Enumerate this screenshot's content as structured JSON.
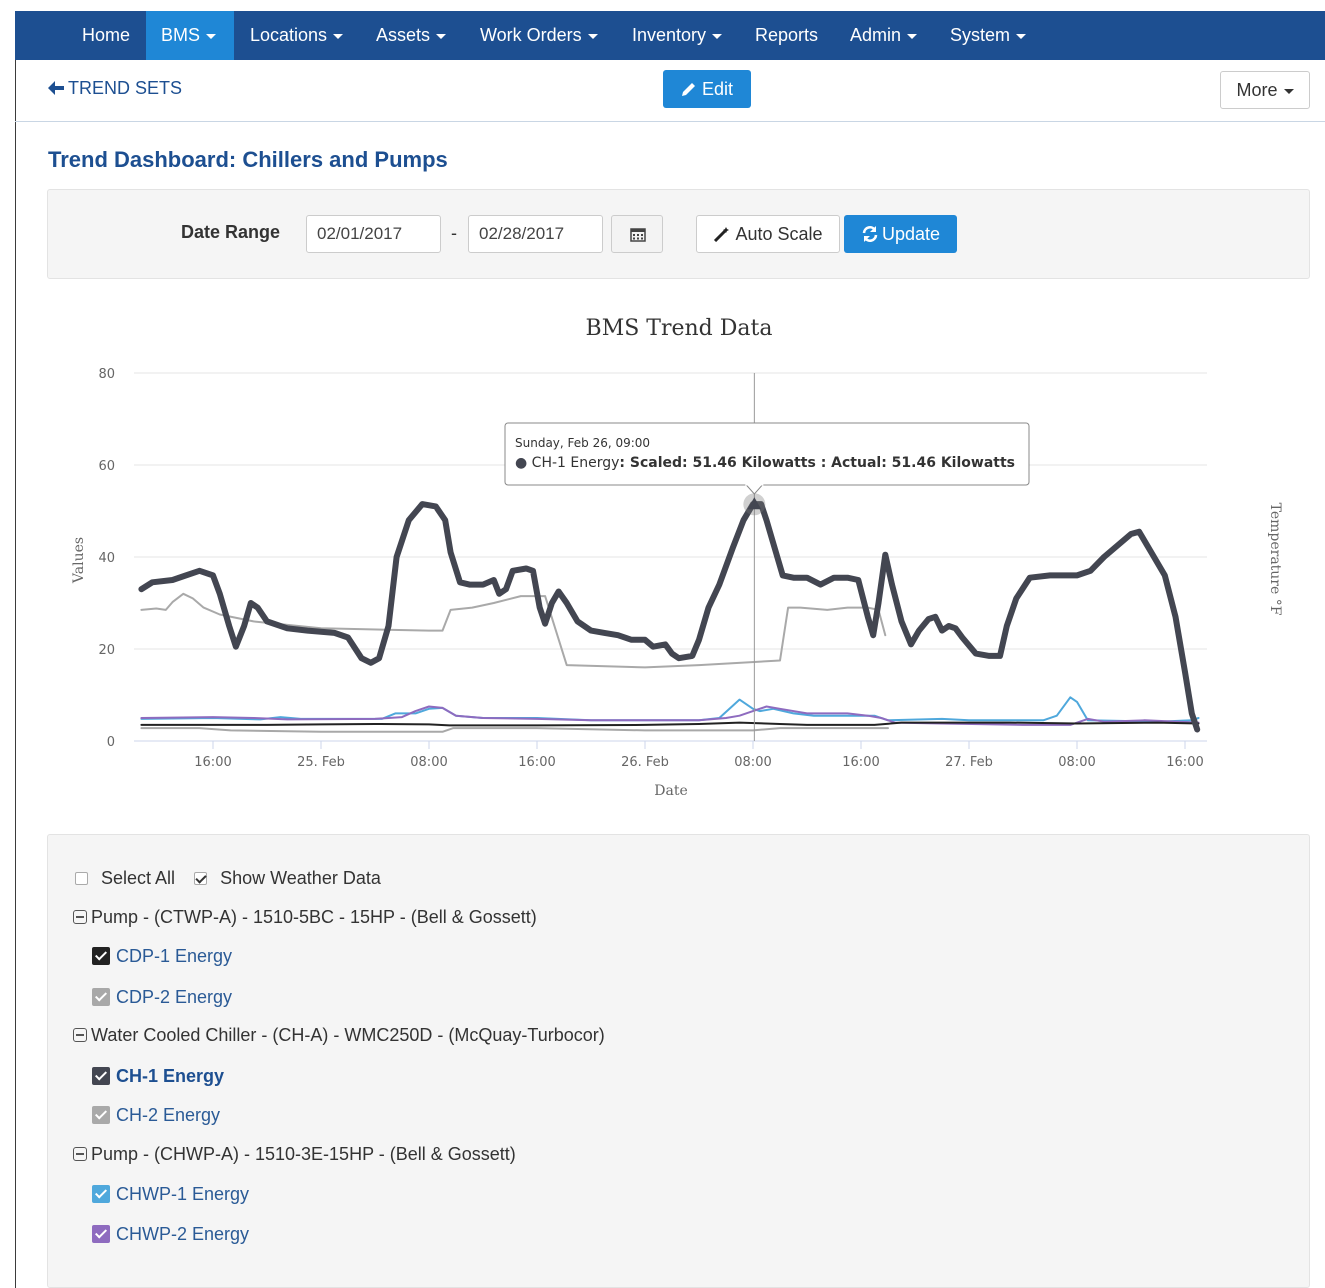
{
  "nav": {
    "items": [
      {
        "label": "Home",
        "caret": false,
        "active": false
      },
      {
        "label": "BMS",
        "caret": true,
        "active": true
      },
      {
        "label": "Locations",
        "caret": true,
        "active": false
      },
      {
        "label": "Assets",
        "caret": true,
        "active": false
      },
      {
        "label": "Work Orders",
        "caret": true,
        "active": false
      },
      {
        "label": "Inventory",
        "caret": true,
        "active": false
      },
      {
        "label": "Reports",
        "caret": false,
        "active": false
      },
      {
        "label": "Admin",
        "caret": true,
        "active": false
      },
      {
        "label": "System",
        "caret": true,
        "active": false
      }
    ]
  },
  "toolbar": {
    "back_label": "TREND SETS",
    "edit_label": "Edit",
    "more_label": "More"
  },
  "page": {
    "title": "Trend Dashboard: Chillers and Pumps"
  },
  "filters": {
    "date_range_label": "Date Range",
    "start_date": "02/01/2017",
    "separator": "-",
    "end_date": "02/28/2017",
    "autoscale_label": "Auto Scale",
    "update_label": "Update"
  },
  "colors": {
    "nav_bg": "#1d4f91",
    "nav_active": "#1f87d6",
    "primary": "#1f87d6",
    "ch1": "#434651",
    "ch2": "#a9a9a9",
    "chwp1": "#4fa8dc",
    "chwp2": "#8e6bbf",
    "cdp1": "#222222",
    "cdp2": "#a8a8a8"
  },
  "chart_data": {
    "type": "line",
    "title": "BMS Trend Data",
    "xlabel": "Date",
    "ylabel": "Values",
    "y2label": "Temperature °F",
    "ylim": [
      0,
      80
    ],
    "yticks": [
      0,
      20,
      40,
      60,
      80
    ],
    "x_unit": "hours since 2017-02-24 00:00",
    "xlim": [
      10.2,
      66.4
    ],
    "xticks": [
      {
        "x": 16,
        "label": "16:00"
      },
      {
        "x": 24,
        "label": "25. Feb"
      },
      {
        "x": 32,
        "label": "08:00"
      },
      {
        "x": 40,
        "label": "16:00"
      },
      {
        "x": 48,
        "label": "26. Feb"
      },
      {
        "x": 56,
        "label": "08:00"
      },
      {
        "x": 64,
        "label": "16:00"
      },
      {
        "x": 72,
        "label": "27. Feb"
      },
      {
        "x": 80,
        "label": "08:00"
      },
      {
        "x": 88,
        "label": "16:00"
      }
    ],
    "grid": true,
    "series": [
      {
        "name": "CH-2 Energy",
        "color": "#a9a9a9",
        "width": 2,
        "points": [
          [
            10.7,
            28.5
          ],
          [
            11.8,
            28.8
          ],
          [
            12.5,
            28.5
          ],
          [
            13.0,
            30.2
          ],
          [
            13.8,
            32.0
          ],
          [
            14.5,
            31.0
          ],
          [
            15.3,
            29.0
          ],
          [
            16.5,
            27.5
          ],
          [
            19.0,
            26.0
          ],
          [
            24.0,
            24.5
          ],
          [
            32.0,
            24.0
          ],
          [
            33.0,
            24.0
          ],
          [
            33.6,
            28.5
          ],
          [
            35.2,
            29.0
          ],
          [
            36.8,
            30.0
          ],
          [
            38.8,
            31.5
          ],
          [
            40.6,
            31.5
          ],
          [
            42.2,
            16.5
          ],
          [
            48.0,
            16.0
          ],
          [
            52.0,
            16.5
          ],
          [
            58.0,
            17.5
          ],
          [
            58.6,
            29.0
          ],
          [
            59.5,
            29.0
          ],
          [
            61.5,
            28.5
          ],
          [
            63.0,
            29.0
          ],
          [
            64.5,
            29.0
          ],
          [
            65.3,
            28.5
          ],
          [
            65.8,
            23.0
          ]
        ]
      },
      {
        "name": "CDP-2 Energy",
        "color": "#a8a8a8",
        "width": 2,
        "points": [
          [
            10.7,
            2.8
          ],
          [
            15.0,
            2.8
          ],
          [
            17.3,
            2.3
          ],
          [
            24.0,
            2.0
          ],
          [
            33.0,
            2.0
          ],
          [
            33.8,
            2.8
          ],
          [
            40.0,
            2.8
          ],
          [
            48.0,
            2.3
          ],
          [
            56.0,
            2.3
          ],
          [
            58.0,
            2.8
          ],
          [
            66.0,
            2.8
          ]
        ]
      },
      {
        "name": "CHWP-1 Energy",
        "color": "#4fa8dc",
        "width": 2,
        "points": [
          [
            10.7,
            4.8
          ],
          [
            16.0,
            5.0
          ],
          [
            19.5,
            4.7
          ],
          [
            21.0,
            5.2
          ],
          [
            22.5,
            4.8
          ],
          [
            28.5,
            4.8
          ],
          [
            29.5,
            6.0
          ],
          [
            31.0,
            6.0
          ],
          [
            32.0,
            7.0
          ],
          [
            33.0,
            7.2
          ],
          [
            34.0,
            5.5
          ],
          [
            36.0,
            5.0
          ],
          [
            40.0,
            5.0
          ],
          [
            44.0,
            4.5
          ],
          [
            52.0,
            4.5
          ],
          [
            53.5,
            5.0
          ],
          [
            55.0,
            9.0
          ],
          [
            56.0,
            7.0
          ],
          [
            56.5,
            6.5
          ],
          [
            57.5,
            7.0
          ],
          [
            59.0,
            6.0
          ],
          [
            60.5,
            5.5
          ],
          [
            65.0,
            5.5
          ],
          [
            66.0,
            4.5
          ],
          [
            70.0,
            4.8
          ],
          [
            72.0,
            4.5
          ],
          [
            77.5,
            4.5
          ],
          [
            78.5,
            5.5
          ],
          [
            79.5,
            9.5
          ],
          [
            80.0,
            8.5
          ],
          [
            80.8,
            4.5
          ],
          [
            86.0,
            4.2
          ],
          [
            88.5,
            4.5
          ],
          [
            89.0,
            5.0
          ]
        ]
      },
      {
        "name": "CHWP-2 Energy",
        "color": "#8e6bbf",
        "width": 2,
        "points": [
          [
            10.7,
            5.0
          ],
          [
            16.0,
            5.2
          ],
          [
            19.0,
            5.0
          ],
          [
            21.5,
            4.7
          ],
          [
            28.0,
            4.8
          ],
          [
            30.0,
            5.2
          ],
          [
            31.0,
            6.5
          ],
          [
            32.0,
            7.5
          ],
          [
            33.0,
            7.2
          ],
          [
            34.0,
            5.5
          ],
          [
            36.0,
            5.0
          ],
          [
            40.0,
            4.8
          ],
          [
            44.0,
            4.5
          ],
          [
            52.0,
            4.5
          ],
          [
            54.0,
            5.0
          ],
          [
            55.0,
            5.5
          ],
          [
            56.0,
            6.5
          ],
          [
            57.0,
            7.5
          ],
          [
            58.0,
            7.0
          ],
          [
            60.0,
            6.0
          ],
          [
            63.0,
            6.0
          ],
          [
            64.5,
            5.5
          ],
          [
            65.5,
            5.0
          ],
          [
            66.5,
            4.0
          ],
          [
            70.0,
            3.8
          ],
          [
            76.0,
            3.5
          ],
          [
            79.5,
            3.5
          ],
          [
            80.8,
            4.8
          ],
          [
            82.0,
            4.2
          ],
          [
            85.0,
            4.5
          ],
          [
            87.5,
            4.2
          ],
          [
            89.0,
            4.0
          ]
        ]
      },
      {
        "name": "CDP-1 Energy",
        "color": "#222222",
        "width": 2,
        "points": [
          [
            10.7,
            3.5
          ],
          [
            20.0,
            3.5
          ],
          [
            24.0,
            3.6
          ],
          [
            28.0,
            3.7
          ],
          [
            32.0,
            3.6
          ],
          [
            33.5,
            3.4
          ],
          [
            40.0,
            3.4
          ],
          [
            48.0,
            3.5
          ],
          [
            52.0,
            3.7
          ],
          [
            55.0,
            4.0
          ],
          [
            58.0,
            3.7
          ],
          [
            60.0,
            3.5
          ],
          [
            65.0,
            3.5
          ],
          [
            67.0,
            4.0
          ],
          [
            75.0,
            4.0
          ],
          [
            80.0,
            3.8
          ],
          [
            86.0,
            4.0
          ],
          [
            89.0,
            3.8
          ]
        ]
      },
      {
        "name": "CH-1 Energy",
        "color": "#434651",
        "width": 6,
        "points": [
          [
            10.7,
            33.0
          ],
          [
            11.5,
            34.5
          ],
          [
            13.0,
            35.0
          ],
          [
            14.0,
            36.0
          ],
          [
            15.0,
            37.0
          ],
          [
            16.0,
            36.0
          ],
          [
            16.5,
            32.0
          ],
          [
            17.2,
            25.0
          ],
          [
            17.7,
            20.5
          ],
          [
            18.3,
            25.0
          ],
          [
            18.8,
            30.0
          ],
          [
            19.3,
            29.0
          ],
          [
            20.0,
            26.0
          ],
          [
            21.5,
            24.5
          ],
          [
            23.0,
            24.0
          ],
          [
            25.0,
            23.5
          ],
          [
            26.0,
            22.5
          ],
          [
            27.0,
            18.0
          ],
          [
            27.7,
            17.0
          ],
          [
            28.3,
            18.0
          ],
          [
            29.0,
            25.0
          ],
          [
            29.6,
            40.0
          ],
          [
            30.5,
            48.0
          ],
          [
            31.5,
            51.5
          ],
          [
            32.5,
            51.0
          ],
          [
            33.2,
            48.0
          ],
          [
            33.6,
            41.0
          ],
          [
            34.3,
            34.5
          ],
          [
            35.0,
            34.0
          ],
          [
            36.0,
            34.0
          ],
          [
            36.8,
            35.0
          ],
          [
            37.2,
            32.0
          ],
          [
            37.7,
            33.0
          ],
          [
            38.2,
            37.0
          ],
          [
            39.2,
            37.5
          ],
          [
            39.7,
            37.0
          ],
          [
            40.2,
            29.0
          ],
          [
            40.6,
            25.5
          ],
          [
            41.1,
            30.0
          ],
          [
            41.6,
            32.5
          ],
          [
            42.2,
            30.0
          ],
          [
            43.0,
            26.0
          ],
          [
            44.0,
            24.0
          ],
          [
            45.0,
            23.5
          ],
          [
            46.0,
            23.0
          ],
          [
            47.0,
            22.0
          ],
          [
            48.0,
            22.0
          ],
          [
            48.6,
            20.5
          ],
          [
            49.5,
            21.0
          ],
          [
            50.0,
            19.0
          ],
          [
            50.5,
            18.0
          ],
          [
            51.5,
            18.5
          ],
          [
            52.0,
            22.0
          ],
          [
            52.7,
            29.0
          ],
          [
            53.5,
            34.0
          ],
          [
            54.5,
            42.0
          ],
          [
            55.3,
            48.0
          ],
          [
            56.0,
            51.5
          ],
          [
            56.6,
            51.5
          ],
          [
            57.0,
            48.0
          ],
          [
            57.6,
            42.0
          ],
          [
            58.2,
            36.0
          ],
          [
            59.0,
            35.5
          ],
          [
            60.0,
            35.5
          ],
          [
            61.0,
            34.0
          ],
          [
            62.0,
            35.5
          ],
          [
            63.0,
            35.5
          ],
          [
            63.8,
            35.0
          ],
          [
            64.5,
            27.0
          ],
          [
            64.9,
            23.0
          ],
          [
            65.3,
            30.0
          ],
          [
            65.8,
            40.5
          ],
          [
            66.3,
            34.0
          ],
          [
            67.0,
            26.0
          ],
          [
            67.7,
            21.0
          ],
          [
            68.3,
            24.0
          ],
          [
            69.0,
            26.5
          ],
          [
            69.5,
            27.0
          ],
          [
            70.0,
            24.0
          ],
          [
            70.5,
            25.0
          ],
          [
            71.0,
            24.5
          ],
          [
            71.5,
            22.5
          ],
          [
            72.5,
            19.0
          ],
          [
            73.5,
            18.5
          ],
          [
            74.3,
            18.5
          ],
          [
            74.8,
            25.0
          ],
          [
            75.5,
            31.0
          ],
          [
            76.5,
            35.5
          ],
          [
            78.0,
            36.0
          ],
          [
            80.0,
            36.0
          ],
          [
            81.0,
            37.0
          ],
          [
            82.0,
            40.0
          ],
          [
            83.0,
            42.5
          ],
          [
            84.0,
            45.0
          ],
          [
            84.6,
            45.5
          ],
          [
            85.5,
            41.0
          ],
          [
            86.5,
            36.0
          ],
          [
            87.3,
            27.0
          ],
          [
            88.0,
            15.0
          ],
          [
            88.5,
            6.0
          ],
          [
            88.9,
            2.5
          ]
        ]
      }
    ],
    "crosshair_x": 56.1,
    "highlight_point": {
      "x": 56.1,
      "y": 51.46
    },
    "tooltip": {
      "date": "Sunday, Feb 26, 09:00",
      "series": "CH-1 Energy",
      "text": ": Scaled: 51.46 Kilowatts : Actual: 51.46 Kilowatts"
    }
  },
  "legend": {
    "select_all_label": "Select All",
    "show_weather_label": "Show Weather Data",
    "groups": [
      {
        "label": "Pump - (CTWP-A) - 1510-5BC - 15HP - (Bell & Gossett)",
        "items": [
          {
            "label": "CDP-1 Energy",
            "color": "#222222",
            "bold": false
          },
          {
            "label": "CDP-2 Energy",
            "color": "#a8a8a8",
            "bold": false
          }
        ]
      },
      {
        "label": "Water Cooled Chiller - (CH-A) - WMC250D - (McQuay-Turbocor)",
        "items": [
          {
            "label": "CH-1 Energy",
            "color": "#434651",
            "bold": true
          },
          {
            "label": "CH-2 Energy",
            "color": "#a9a9a9",
            "bold": false
          }
        ]
      },
      {
        "label": "Pump - (CHWP-A) - 1510-3E-15HP - (Bell & Gossett)",
        "items": [
          {
            "label": "CHWP-1 Energy",
            "color": "#4fa8dc",
            "bold": false
          },
          {
            "label": "CHWP-2 Energy",
            "color": "#8e6bbf",
            "bold": false
          }
        ]
      }
    ]
  }
}
